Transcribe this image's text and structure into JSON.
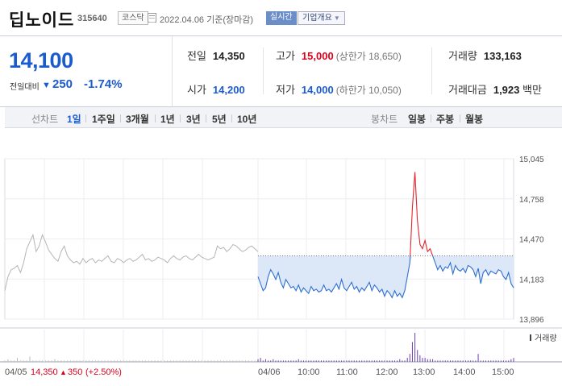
{
  "header": {
    "stock_name": "딥노이드",
    "stock_code": "315640",
    "market_badge": "코스닥",
    "date": "2022.04.06 기준(장마감)",
    "realtime_label": "실시간",
    "company_info_label": "기업개요"
  },
  "quote": {
    "price": "14,100",
    "vs_label": "전일대비",
    "change": "250",
    "change_pct": "-1.74%",
    "prev_label": "전일",
    "prev_value": "14,350",
    "high_label": "고가",
    "high_value": "15,000",
    "upper_limit": "(상한가 18,650)",
    "volume_label": "거래량",
    "volume_value": "133,163",
    "open_label": "시가",
    "open_value": "14,200",
    "low_label": "저가",
    "low_value": "14,000",
    "lower_limit": "(하한가 10,050)",
    "amount_label": "거래대금",
    "amount_value": "1,923",
    "amount_unit": "백만"
  },
  "period_bar": {
    "line_label": "선차트",
    "line_periods": [
      "1일",
      "1주일",
      "3개월",
      "1년",
      "3년",
      "5년",
      "10년"
    ],
    "selected": "1일",
    "candle_label": "봉차트",
    "candle_periods": [
      "일봉",
      "주봉",
      "월봉"
    ]
  },
  "chart_data": {
    "type": "line",
    "ylim": [
      13896,
      15045
    ],
    "y_ticks": [
      "15,045",
      "14,758",
      "14,470",
      "14,183",
      "13,896"
    ],
    "prev_close": 14350,
    "x_labels": [
      "04/05",
      "04/06",
      "10:00",
      "11:00",
      "12:00",
      "13:00",
      "14:00",
      "15:00"
    ],
    "volume_label": "거래량",
    "prev_day_footer": {
      "date": "04/05",
      "price": "14,350",
      "change": "350",
      "pct": "(+2.50%)"
    },
    "prev_day_series": [
      14100,
      14200,
      14250,
      14260,
      14280,
      14230,
      14300,
      14400,
      14450,
      14500,
      14380,
      14420,
      14500,
      14450,
      14390,
      14360,
      14330,
      14310,
      14380,
      14420,
      14350,
      14320,
      14300,
      14310,
      14290,
      14330,
      14300,
      14320,
      14330,
      14300,
      14320,
      14310,
      14330,
      14350,
      14310,
      14300,
      14330,
      14320,
      14300,
      14320,
      14330,
      14310,
      14320,
      14340,
      14360,
      14320,
      14330,
      14310,
      14320,
      14340,
      14330,
      14320,
      14300,
      14330,
      14350,
      14330,
      14320,
      14340,
      14350,
      14330,
      14320,
      14340,
      14360,
      14340,
      14330,
      14320,
      14330,
      14340,
      14420,
      14400,
      14410,
      14380,
      14400,
      14430,
      14420,
      14400,
      14380,
      14390,
      14410,
      14420,
      14400,
      14380
    ],
    "today_series": [
      14200,
      14150,
      14100,
      14120,
      14200,
      14250,
      14220,
      14180,
      14230,
      14160,
      14120,
      14180,
      14150,
      14120,
      14130,
      14100,
      14140,
      14090,
      14120,
      14100,
      14080,
      14130,
      14100,
      14110,
      14090,
      14100,
      14140,
      14100,
      14110,
      14090,
      14120,
      14150,
      14110,
      14180,
      14120,
      14100,
      14130,
      14160,
      14110,
      14130,
      14090,
      14120,
      14100,
      14130,
      14160,
      14100,
      14140,
      14120,
      14090,
      14110,
      14060,
      14100,
      14080,
      14050,
      14100,
      14060,
      14080,
      14050,
      14100,
      14200,
      14300,
      14700,
      14950,
      14600,
      14430,
      14400,
      14460,
      14380,
      14400,
      14350,
      14300,
      14250,
      14280,
      14240,
      14270,
      14260,
      14300,
      14220,
      14280,
      14250,
      14240,
      14260,
      14230,
      14280,
      14270,
      14250,
      14200,
      14260,
      14150,
      14230,
      14250,
      14210,
      14240,
      14230,
      14220,
      14250,
      14240,
      14200,
      14180,
      14230,
      14150,
      14120
    ],
    "today_volume": [
      2,
      3,
      1,
      2,
      1,
      1,
      2,
      1,
      1,
      1,
      1,
      1,
      1,
      1,
      1,
      1,
      2,
      1,
      1,
      1,
      1,
      1,
      1,
      1,
      1,
      1,
      1,
      1,
      1,
      1,
      1,
      1,
      1,
      1,
      1,
      1,
      1,
      1,
      1,
      1,
      1,
      1,
      1,
      1,
      1,
      1,
      1,
      1,
      1,
      1,
      1,
      1,
      1,
      1,
      1,
      1,
      2,
      1,
      1,
      3,
      6,
      15,
      22,
      9,
      5,
      3,
      3,
      2,
      2,
      2,
      1,
      1,
      1,
      1,
      1,
      1,
      1,
      1,
      1,
      1,
      1,
      1,
      1,
      1,
      1,
      1,
      1,
      6,
      1,
      1,
      1,
      1,
      1,
      1,
      1,
      1,
      1,
      1,
      1,
      1,
      2,
      3
    ],
    "prev_volume": [
      1,
      2,
      1,
      1,
      3,
      1,
      1,
      1,
      4,
      1,
      1,
      1,
      1,
      1,
      1,
      1,
      2,
      1,
      1,
      1,
      1,
      1,
      1,
      1,
      1,
      1,
      1,
      1,
      1,
      1,
      1,
      1,
      1,
      1,
      1,
      1,
      1,
      1,
      1,
      1,
      1,
      1,
      1,
      1,
      1,
      1,
      1,
      1,
      1,
      1,
      1,
      1,
      1,
      1,
      1,
      1,
      1,
      1,
      1,
      1,
      1,
      1,
      1,
      1,
      1,
      1,
      1,
      1,
      1,
      1,
      1,
      1,
      1,
      1,
      1,
      1,
      1,
      1,
      1,
      1,
      1,
      1
    ],
    "colors": {
      "prev": "#b5b5b5",
      "today": "#2e6fd1",
      "above": "#e3242b",
      "fill": "#dce8f8",
      "volume": "#6a3fb0"
    }
  }
}
